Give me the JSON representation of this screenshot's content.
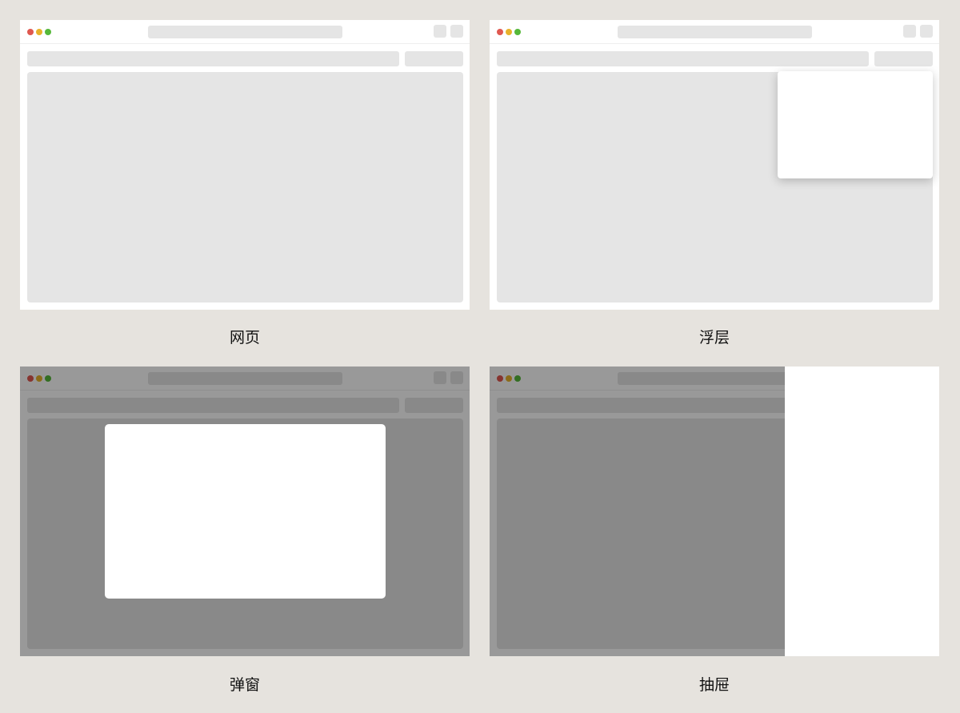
{
  "panels": [
    {
      "caption": "网页",
      "variant": "webpage"
    },
    {
      "caption": "浮层",
      "variant": "popover"
    },
    {
      "caption": "弹窗",
      "variant": "modal"
    },
    {
      "caption": "抽屉",
      "variant": "drawer"
    }
  ],
  "colors": {
    "background": "#e6e3de",
    "window": "#ffffff",
    "placeholder": "#e5e5e5",
    "dot_red": "#e0584f",
    "dot_yellow": "#e8b22a",
    "dot_green": "#56b83a",
    "overlay": "rgba(0,0,0,0.40)"
  }
}
